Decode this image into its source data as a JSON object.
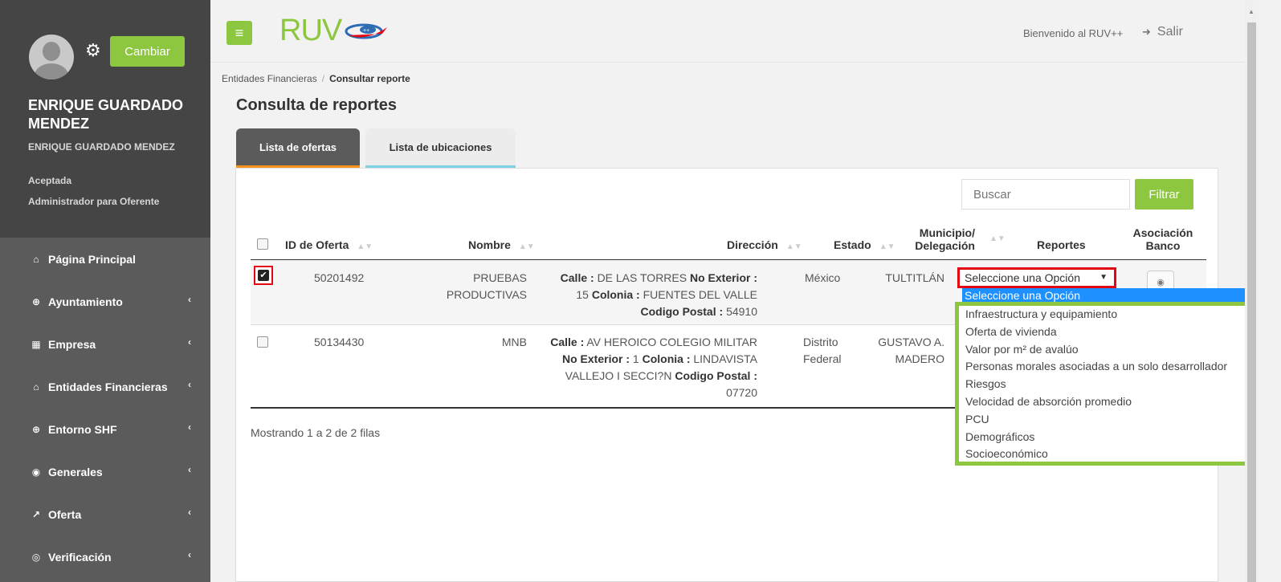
{
  "sidebar": {
    "change_label": "Cambiar",
    "user_name": "ENRIQUE GUARDADO MENDEZ",
    "user_sub": "ENRIQUE GUARDADO MENDEZ",
    "user_status": "Aceptada",
    "user_role": "Administrador para Oferente",
    "items": [
      {
        "label": "Página Principal",
        "icon": "home-icon",
        "glyph": "⌂",
        "has_chevron": false
      },
      {
        "label": "Ayuntamiento",
        "icon": "plus-circle-icon",
        "glyph": "⊕",
        "has_chevron": true
      },
      {
        "label": "Empresa",
        "icon": "building-icon",
        "glyph": "▦",
        "has_chevron": true
      },
      {
        "label": "Entidades Financieras",
        "icon": "bank-icon",
        "glyph": "⌂",
        "has_chevron": true
      },
      {
        "label": "Entorno SHF",
        "icon": "plus-circle-icon",
        "glyph": "⊕",
        "has_chevron": true
      },
      {
        "label": "Generales",
        "icon": "dashboard-icon",
        "glyph": "◉",
        "has_chevron": true
      },
      {
        "label": "Oferta",
        "icon": "line-chart-icon",
        "glyph": "↗",
        "has_chevron": true
      },
      {
        "label": "Verificación",
        "icon": "target-icon",
        "glyph": "◎",
        "has_chevron": true
      }
    ],
    "chevron": "‹"
  },
  "topbar": {
    "logo_text": "RUV",
    "welcome": "Bienvenido al RUV++",
    "logout": "Salir"
  },
  "breadcrumb": {
    "parent": "Entidades Financieras",
    "separator": "/",
    "current": "Consultar reporte"
  },
  "page_title": "Consulta de reportes",
  "tabs": [
    {
      "label": "Lista de ofertas",
      "active": true
    },
    {
      "label": "Lista de ubicaciones",
      "active": false
    }
  ],
  "toolbar": {
    "search_placeholder": "Buscar",
    "filter_label": "Filtrar"
  },
  "table": {
    "headers": {
      "id": "ID de Oferta",
      "nombre": "Nombre",
      "direccion": "Dirección",
      "estado": "Estado",
      "municipio_1": "Municipio/",
      "municipio_2": "Delegación",
      "reportes": "Reportes",
      "asociacion_1": "Asociación",
      "asociacion_2": "Banco"
    },
    "rows": [
      {
        "checked": true,
        "id": "50201492",
        "nombre_1": "PRUEBAS",
        "nombre_2": "PRODUCTIVAS",
        "calle_label": "Calle :",
        "calle": "DE LAS TORRES",
        "noext_label": "No Exterior :",
        "noext": "15",
        "colonia_label": "Colonia :",
        "colonia": "FUENTES DEL VALLE",
        "cp_label": "Codigo Postal :",
        "cp": "54910",
        "estado": "México",
        "municipio": "TULTITLÁN"
      },
      {
        "checked": false,
        "id": "50134430",
        "nombre_1": "MNB",
        "calle_label": "Calle :",
        "calle": "AV HEROICO COLEGIO MILITAR",
        "noext_label": "No Exterior :",
        "noext": "1",
        "colonia_label": "Colonia :",
        "colonia": "LINDAVISTA",
        "colonia_2": "VALLEJO I SECCI?N",
        "cp_label": "Codigo Postal :",
        "cp": "07720",
        "estado_1": "Distrito",
        "estado_2": "Federal",
        "municipio_1": "GUSTAVO A.",
        "municipio_2": "MADERO"
      }
    ]
  },
  "reportes_select": {
    "selected": "Seleccione una Opción",
    "options": [
      "Infraestructura y equipamiento",
      "Oferta de vivienda",
      "Valor por m² de avalúo",
      "Personas morales asociadas a un solo desarrollador",
      "Riesgos",
      "Velocidad de absorción promedio",
      "PCU",
      "Demográficos",
      "Socioeconómico"
    ]
  },
  "footer": {
    "showing": "Mostrando 1 a 2 de 2 filas"
  },
  "colors": {
    "accent_green": "#8dc63f",
    "highlight_red": "#e30613",
    "sidebar_dark": "#454545",
    "sidebar": "#5b5b5b"
  }
}
